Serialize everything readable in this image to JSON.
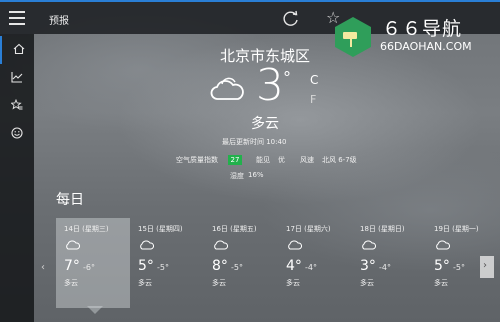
{
  "app": {
    "title": "预报"
  },
  "watermark": {
    "title": "６６导航",
    "url": "66DAOHAN.COM"
  },
  "location": "北京市东城区",
  "current": {
    "temp": "3",
    "deg": "°",
    "unit_c": "C",
    "unit_f": "F",
    "condition": "多云",
    "updated": "最后更新时间 10:40",
    "aqi_label": "空气质量指数",
    "aqi_value": "27",
    "visibility_label": "能见",
    "visibility_value": "优",
    "wind_label": "风速",
    "wind_value": "北风 6-7级",
    "humidity_label": "湿度",
    "humidity_value": "16%"
  },
  "daily": {
    "title": "每日",
    "days": [
      {
        "date": "14日 (星期三)",
        "high": "7°",
        "low": "-6°",
        "cond": "多云"
      },
      {
        "date": "15日 (星期四)",
        "high": "5°",
        "low": "-5°",
        "cond": "多云"
      },
      {
        "date": "16日 (星期五)",
        "high": "8°",
        "low": "-5°",
        "cond": "多云"
      },
      {
        "date": "17日 (星期六)",
        "high": "4°",
        "low": "-4°",
        "cond": "多云"
      },
      {
        "date": "18日 (星期日)",
        "high": "3°",
        "low": "-4°",
        "cond": "多云"
      },
      {
        "date": "19日 (星期一)",
        "high": "5°",
        "low": "-5°",
        "cond": "多云"
      }
    ]
  },
  "icons": {
    "menu": "hamburger-icon",
    "refresh": "refresh-icon",
    "favorite": "star-icon",
    "home": "home-icon",
    "charts": "chart-icon",
    "favorites": "star-list-icon",
    "feedback": "smiley-icon",
    "weather": "cloud-icon"
  },
  "colors": {
    "accent": "#2a7fd6",
    "aqi": "#22b14c"
  }
}
